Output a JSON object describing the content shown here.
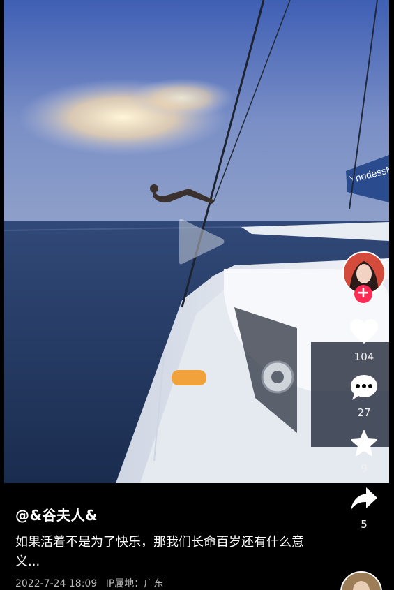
{
  "video": {
    "play_icon": "play-icon",
    "boat_label": "YnodessNa"
  },
  "actions": {
    "like": {
      "icon": "heart-icon",
      "count": "104"
    },
    "comment": {
      "icon": "comment-icon",
      "count": "27"
    },
    "favorite": {
      "icon": "star-icon",
      "count": "9"
    },
    "share": {
      "icon": "share-icon",
      "count": "5"
    }
  },
  "author": {
    "name": "@&谷夫人&",
    "follow_icon": "plus-icon"
  },
  "caption": "如果活着不是为了快乐，那我们长命百岁还有什么意义...",
  "info": {
    "date": "2022-7-24 18:09",
    "ip_location": "IP属地：广东"
  },
  "colors": {
    "accent": "#fe2c55",
    "background": "#000000"
  }
}
